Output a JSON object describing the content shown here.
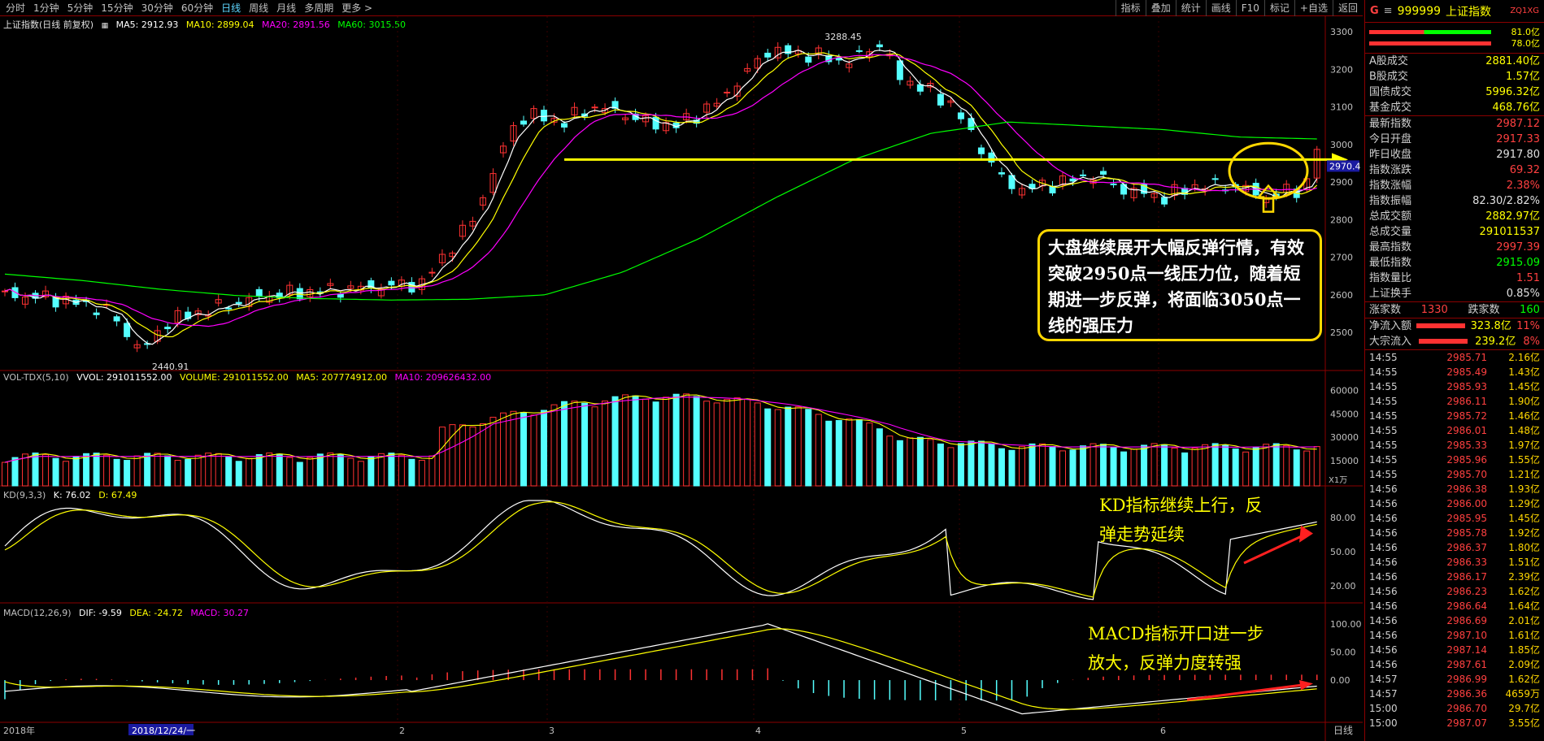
{
  "toolbar": {
    "periods": [
      "分时",
      "1分钟",
      "5分钟",
      "15分钟",
      "30分钟",
      "60分钟",
      "日线",
      "周线",
      "月线",
      "多周期",
      "更多 >"
    ],
    "active": "日线",
    "tools": [
      "指标",
      "叠加",
      "统计",
      "画线",
      "F10",
      "标记",
      "+自选",
      "返回"
    ]
  },
  "main_header": {
    "name": "上证指数(日线 前复权)",
    "ma5": "MA5: 2912.93",
    "ma10": "MA10: 2899.04",
    "ma20": "MA20: 2891.56",
    "ma60": "MA60: 3015.50"
  },
  "vol_header": {
    "name": "VOL-TDX(5,10)",
    "vvol": "VVOL: 291011552.00",
    "volume": "VOLUME: 291011552.00",
    "ma5": "MA5: 207774912.00",
    "ma10": "MA10: 209626432.00",
    "unit": "X1万"
  },
  "kd_header": {
    "name": "KD(9,3,3)",
    "k": "K: 76.02",
    "d": "D: 67.49"
  },
  "macd_header": {
    "name": "MACD(12,26,9)",
    "dif": "DIF: -9.59",
    "dea": "DEA: -24.72",
    "macd": "MACD: 30.27"
  },
  "price_labels": {
    "high": "3288.45",
    "low": "2440.91",
    "cur": "2970.4"
  },
  "x_labels": [
    "2018年",
    "2018/12/24/一",
    "2",
    "3",
    "4",
    "5",
    "6"
  ],
  "status": "日线",
  "colors": {
    "up": "#ff3232",
    "down": "#54ffff",
    "ma5": "#ffffff",
    "ma10": "#ffff00",
    "ma20": "#ff00ff",
    "ma60": "#00ff00",
    "grid": "#8b0000"
  },
  "chart_data": [
    {
      "type": "candlestick",
      "panel": "price",
      "title": "上证指数(日线 前复权)",
      "y_ticks": [
        2500,
        2600,
        2700,
        2800,
        2900,
        3000,
        3100,
        3200,
        3300
      ],
      "ylim": [
        2420,
        3320
      ],
      "annotations": [
        "3288.45",
        "2440.91",
        "2970.4"
      ],
      "ma60": [
        2655,
        2638,
        2615,
        2598,
        2590,
        2586,
        2588,
        2600,
        2660,
        2750,
        2860,
        2960,
        3030,
        3060,
        3050,
        3040,
        3020,
        3015
      ]
    },
    {
      "type": "bar",
      "panel": "volume",
      "y_ticks": [
        15000,
        30000,
        45000,
        60000
      ],
      "ylim": [
        0,
        68000
      ],
      "unit": "X1万"
    },
    {
      "type": "line",
      "panel": "kd",
      "series": [
        {
          "name": "K",
          "values": []
        },
        {
          "name": "D",
          "values": []
        }
      ],
      "y_ticks": [
        20,
        50,
        80
      ],
      "ylim": [
        5,
        105
      ]
    },
    {
      "type": "bar",
      "panel": "macd",
      "y_ticks": [
        0,
        50,
        100
      ],
      "ylim": [
        -75,
        130
      ]
    }
  ],
  "annotations": {
    "bubble": "大盘继续展开大幅反弹行情，有效突破2950点一线压力位，随着短期进一步反弹，将面临3050点一线的强压力",
    "kd": [
      "KD指标继续上行，反",
      "弹走势延续"
    ],
    "macd": [
      "MACD指标开口进一步",
      "放大，反弹力度转强"
    ]
  },
  "side": {
    "code": "999999",
    "name": "上证指数",
    "tag": "ZQ1XG",
    "bars": [
      "81.0亿",
      "78.0亿"
    ],
    "vols": [
      [
        "A股成交",
        "2881.40亿"
      ],
      [
        "B股成交",
        "1.57亿"
      ],
      [
        "国债成交",
        "5996.32亿"
      ],
      [
        "基金成交",
        "468.76亿"
      ]
    ],
    "stats": [
      [
        "最新指数",
        "2987.12",
        "r"
      ],
      [
        "今日开盘",
        "2917.33",
        "r"
      ],
      [
        "昨日收盘",
        "2917.80",
        "w"
      ],
      [
        "指数涨跌",
        "69.32",
        "r"
      ],
      [
        "指数涨幅",
        "2.38%",
        "r"
      ],
      [
        "指数振幅",
        "82.30/2.82%",
        "w"
      ],
      [
        "总成交额",
        "2882.97亿",
        "y"
      ],
      [
        "总成交量",
        "291011537",
        "y"
      ],
      [
        "最高指数",
        "2997.39",
        "r"
      ],
      [
        "最低指数",
        "2915.09",
        "g"
      ],
      [
        "指数量比",
        "1.51",
        "r"
      ],
      [
        "上证换手",
        "0.85%",
        "w"
      ]
    ],
    "breadth": {
      "up_label": "涨家数",
      "up": "1330",
      "down_label": "跌家数",
      "down": "160"
    },
    "flows": [
      [
        "净流入额",
        "323.8亿",
        "11%"
      ],
      [
        "大宗流入",
        "239.2亿",
        "8%"
      ]
    ],
    "ticks": [
      [
        "14:55",
        "2985.71",
        "2.16亿"
      ],
      [
        "14:55",
        "2985.49",
        "1.43亿"
      ],
      [
        "14:55",
        "2985.93",
        "1.45亿"
      ],
      [
        "14:55",
        "2986.11",
        "1.90亿"
      ],
      [
        "14:55",
        "2985.72",
        "1.46亿"
      ],
      [
        "14:55",
        "2986.01",
        "1.48亿"
      ],
      [
        "14:55",
        "2985.33",
        "1.97亿"
      ],
      [
        "14:55",
        "2985.96",
        "1.55亿"
      ],
      [
        "14:55",
        "2985.70",
        "1.21亿"
      ],
      [
        "14:56",
        "2986.38",
        "1.93亿"
      ],
      [
        "14:56",
        "2986.00",
        "1.29亿"
      ],
      [
        "14:56",
        "2985.95",
        "1.45亿"
      ],
      [
        "14:56",
        "2985.78",
        "1.92亿"
      ],
      [
        "14:56",
        "2986.37",
        "1.80亿"
      ],
      [
        "14:56",
        "2986.33",
        "1.51亿"
      ],
      [
        "14:56",
        "2986.17",
        "2.39亿"
      ],
      [
        "14:56",
        "2986.23",
        "1.62亿"
      ],
      [
        "14:56",
        "2986.64",
        "1.64亿"
      ],
      [
        "14:56",
        "2986.69",
        "2.01亿"
      ],
      [
        "14:56",
        "2987.10",
        "1.61亿"
      ],
      [
        "14:56",
        "2987.14",
        "1.85亿"
      ],
      [
        "14:56",
        "2987.61",
        "2.09亿"
      ],
      [
        "14:57",
        "2986.99",
        "1.62亿"
      ],
      [
        "14:57",
        "2986.36",
        "4659万"
      ],
      [
        "15:00",
        "2986.70",
        "29.7亿"
      ],
      [
        "15:00",
        "2987.07",
        "3.55亿"
      ]
    ]
  }
}
